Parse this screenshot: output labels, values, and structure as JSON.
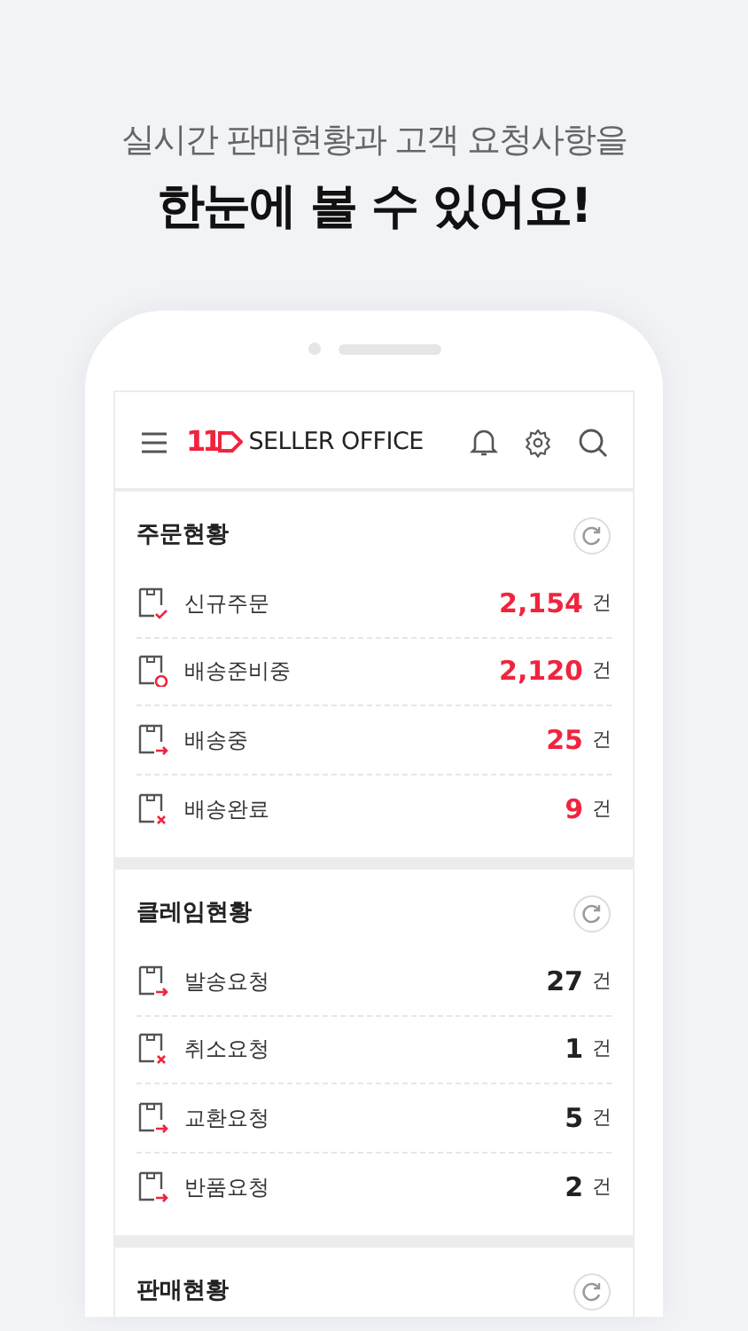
{
  "headline": {
    "subtitle": "실시간 판매현황과 고객 요청사항을",
    "title": "한눈에 볼 수 있어요!"
  },
  "app_bar": {
    "logo_mark": "11",
    "title": "SELLER OFFICE"
  },
  "sections": [
    {
      "title": "주문현황",
      "kind": "orders",
      "rows": [
        {
          "label": "신규주문",
          "count": "2,154",
          "unit": "건"
        },
        {
          "label": "배송준비중",
          "count": "2,120",
          "unit": "건"
        },
        {
          "label": "배송중",
          "count": "25",
          "unit": "건"
        },
        {
          "label": "배송완료",
          "count": "9",
          "unit": "건"
        }
      ]
    },
    {
      "title": "클레임현황",
      "kind": "claims",
      "rows": [
        {
          "label": "발송요청",
          "count": "27",
          "unit": "건"
        },
        {
          "label": "취소요청",
          "count": "1",
          "unit": "건"
        },
        {
          "label": "교환요청",
          "count": "5",
          "unit": "건"
        },
        {
          "label": "반품요청",
          "count": "2",
          "unit": "건"
        }
      ]
    },
    {
      "title": "판매현황"
    }
  ]
}
